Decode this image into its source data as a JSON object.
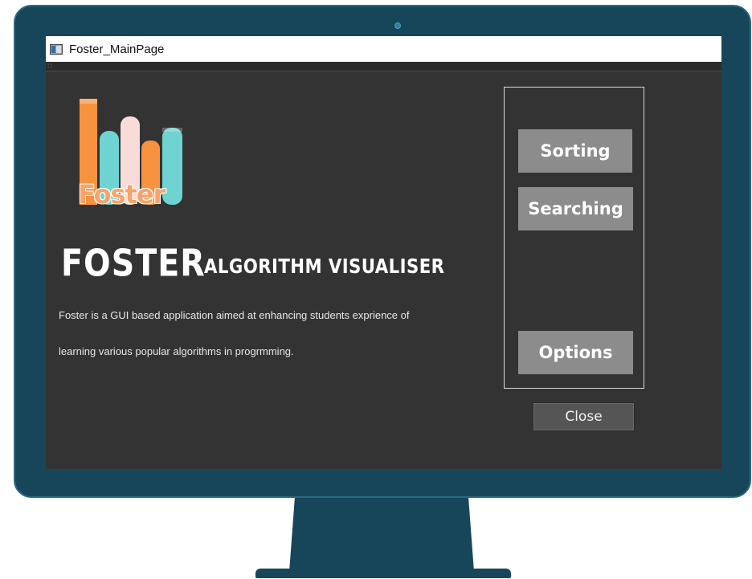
{
  "window": {
    "title": "Foster_MainPage"
  },
  "logo": {
    "text": "Foster"
  },
  "header": {
    "app_name": "FOSTER",
    "subtitle": "ALGORITHM VISUALISER"
  },
  "description": {
    "line1": "Foster is a GUI based application aimed at enhancing students exprience of",
    "line2": "learning various popular algorithms in progrmming."
  },
  "menu": {
    "sorting": "Sorting",
    "searching": "Searching",
    "options": "Options",
    "close": "Close"
  },
  "colors": {
    "window_bg": "#333333",
    "button_bg": "#8c8c8c",
    "close_bg": "#555555",
    "monitor": "#17465a",
    "logo_orange": "#f7933e",
    "logo_teal": "#6fd3d1",
    "logo_pink": "#f8dcda"
  }
}
